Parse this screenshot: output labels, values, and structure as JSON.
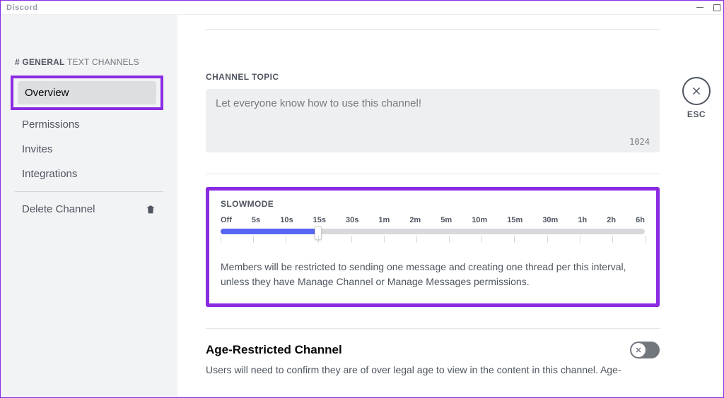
{
  "titlebar": {
    "app_name": "Discord"
  },
  "close": {
    "esc_label": "ESC"
  },
  "sidebar": {
    "heading_hash": "#",
    "heading_bold": "GENERAL",
    "heading_plain": "TEXT CHANNELS",
    "items": {
      "overview": "Overview",
      "permissions": "Permissions",
      "invites": "Invites",
      "integrations": "Integrations",
      "delete": "Delete Channel"
    }
  },
  "topic": {
    "label": "CHANNEL TOPIC",
    "placeholder": "Let everyone know how to use this channel!",
    "char_count": "1024"
  },
  "slowmode": {
    "label": "SLOWMODE",
    "ticks": [
      "Off",
      "5s",
      "10s",
      "15s",
      "30s",
      "1m",
      "2m",
      "5m",
      "10m",
      "15m",
      "30m",
      "1h",
      "2h",
      "6h"
    ],
    "selected_index": 3,
    "description": "Members will be restricted to sending one message and creating one thread per this interval, unless they have Manage Channel or Manage Messages permissions."
  },
  "age": {
    "title": "Age-Restricted Channel",
    "description": "Users will need to confirm they are of over legal age to view in the content in this channel. Age-",
    "enabled": false
  }
}
